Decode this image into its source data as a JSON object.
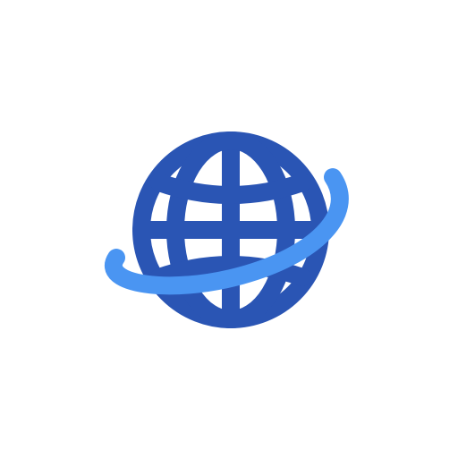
{
  "icon": {
    "name": "globe-orbit-icon",
    "colors": {
      "globe": "#2a55b4",
      "orbit": "#4a95f2",
      "background": "#ffffff"
    }
  }
}
